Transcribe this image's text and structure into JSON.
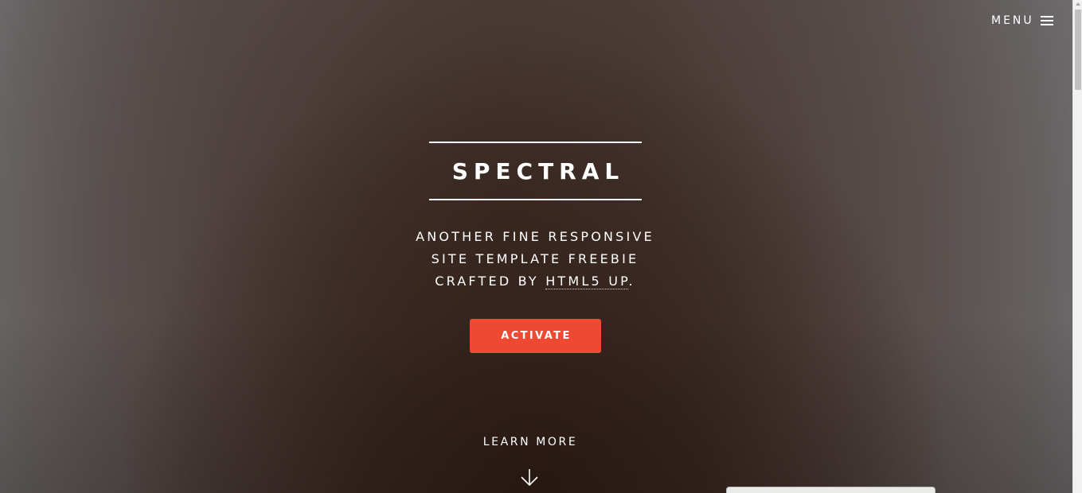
{
  "header": {
    "menu_label": "MENU",
    "menu_icon": "hamburger-icon"
  },
  "banner": {
    "title": "SPECTRAL",
    "tagline_line1": "ANOTHER FINE RESPONSIVE",
    "tagline_line2": "SITE TEMPLATE FREEBIE",
    "tagline_line3_prefix": "CRAFTED BY ",
    "tagline_link": "HTML5 UP",
    "tagline_line3_suffix": ".",
    "activate_label": "ACTIVATE",
    "learn_more_label": "LEARN MORE",
    "learn_more_icon": "arrow-down-icon"
  },
  "colors": {
    "accent": "#ed4933",
    "text": "#ffffff"
  }
}
